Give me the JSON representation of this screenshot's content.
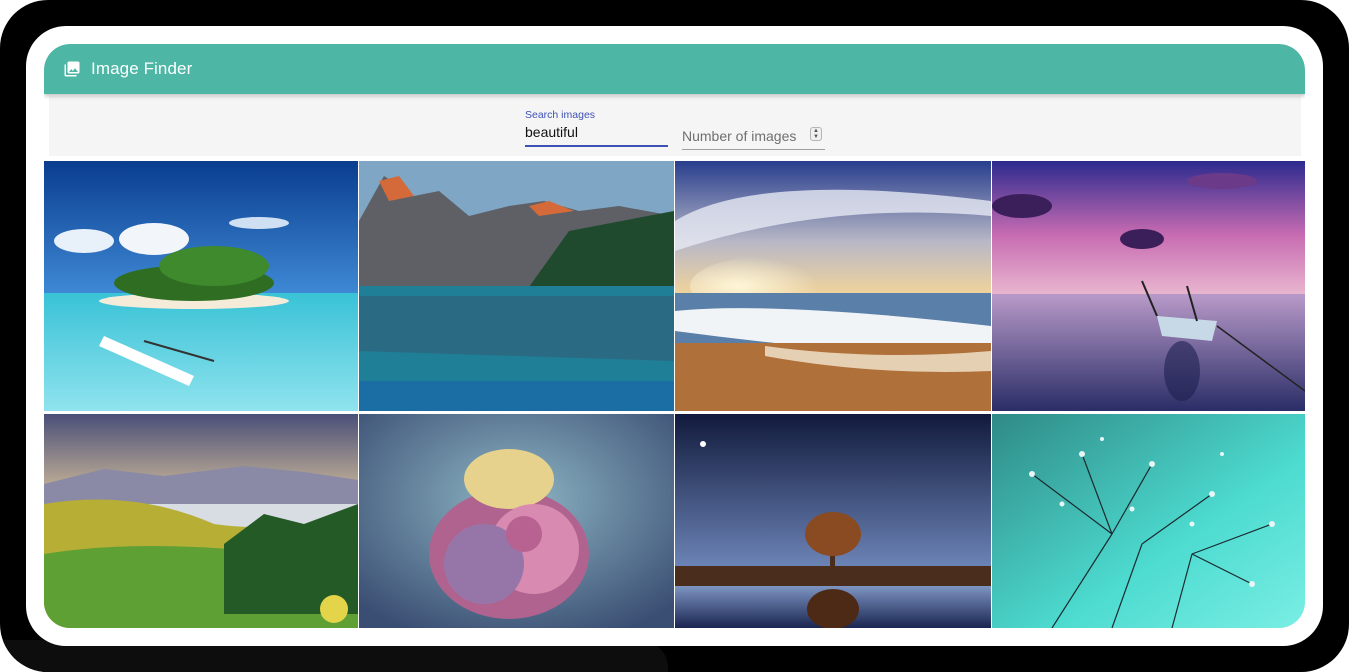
{
  "app": {
    "title": "Image Finder",
    "logo_icon": "image-gallery-icon",
    "accent_color": "#4db6a4",
    "input_accent_color": "#3f51b5"
  },
  "search": {
    "label": "Search images",
    "value": "beautiful",
    "count_placeholder": "Number of images",
    "count_icon": "spinner-arrows-icon"
  },
  "results": [
    {
      "subject": "tropical-island"
    },
    {
      "subject": "mountain-lake"
    },
    {
      "subject": "sunset-beach"
    },
    {
      "subject": "boat-at-dusk"
    },
    {
      "subject": "misty-hills"
    },
    {
      "subject": "rose"
    },
    {
      "subject": "tree-reflection-night"
    },
    {
      "subject": "dandelion-drops"
    }
  ]
}
